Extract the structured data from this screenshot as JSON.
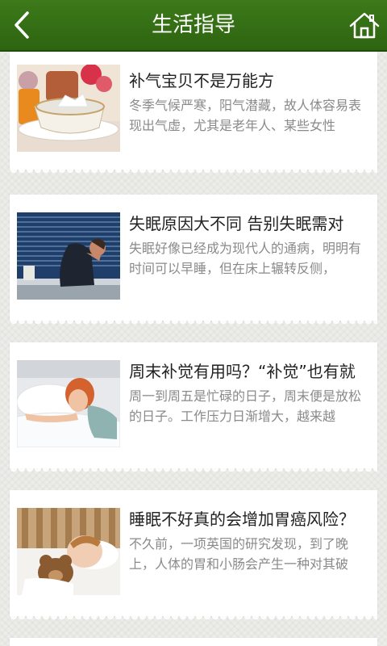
{
  "header": {
    "title": "生活指导"
  },
  "articles": [
    {
      "title": "补气宝贝不是万能方",
      "excerpt": "冬季气候严寒，阳气潜藏，故人体容易表现出气虚，尤其是老年人、某些女性"
    },
    {
      "title": "失眠原因大不同 告别失眠需对",
      "excerpt": "失眠好像已经成为现代人的通病，明明有时间可以早睡，但在床上辗转反侧，"
    },
    {
      "title": "周末补觉有用吗？“补觉”也有就",
      "excerpt": "周一到周五是忙碌的日子，周末便是放松的日子。工作压力日渐增大，越来越"
    },
    {
      "title": "睡眠不好真的会增加胃癌风险？",
      "excerpt": "不久前，一项英国的研究发现，到了晚上，人体的胃和小肠会产生一种对其破"
    }
  ]
}
